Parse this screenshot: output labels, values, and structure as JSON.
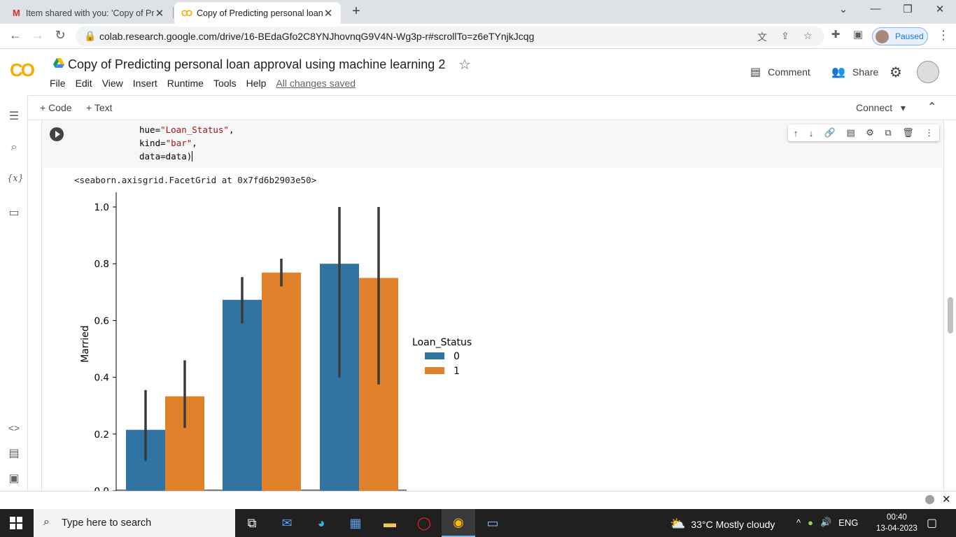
{
  "browser": {
    "tabs": [
      {
        "title": "Item shared with you: 'Copy of Pr",
        "icon": "gmail-icon"
      },
      {
        "title": "Copy of Predicting personal loan",
        "icon": "colab-icon"
      }
    ],
    "url": "colab.research.google.com/drive/16-BEdaGfo2C8YNJhovnqG9V4N-Wg3p-r#scrollTo=z6eTYnjkJcqg",
    "profile_label": "Paused"
  },
  "colab": {
    "logo_text": "CO",
    "notebook_title": "Copy of Predicting personal loan approval using machine learning 2",
    "menu": [
      "File",
      "Edit",
      "View",
      "Insert",
      "Runtime",
      "Tools",
      "Help"
    ],
    "save_status": "All changes saved",
    "comment_label": "Comment",
    "share_label": "Share",
    "add_code_label": "+ Code",
    "add_text_label": "+ Text",
    "connect_label": "Connect"
  },
  "cell": {
    "code_lines": [
      {
        "prefix": "hue=",
        "string": "\"Loan_Status\"",
        "suffix": ","
      },
      {
        "prefix": "kind=",
        "string": "\"bar\"",
        "suffix": ","
      },
      {
        "prefix": "data=data)",
        "string": "",
        "suffix": ""
      }
    ],
    "output_repr": "<seaborn.axisgrid.FacetGrid at 0x7fd6b2903e50>"
  },
  "chart_data": {
    "type": "bar",
    "ylabel": "Married",
    "yticks": [
      "0.0",
      "0.2",
      "0.4",
      "0.6",
      "0.8",
      "1.0"
    ],
    "ylim": [
      0,
      1.04
    ],
    "legend_title": "Loan_Status",
    "legend_position": "right",
    "categories_count": 3,
    "series": [
      {
        "name": "0",
        "color": "#3274a1",
        "values": [
          0.215,
          0.673,
          0.8
        ],
        "ci": [
          [
            0.105,
            0.355
          ],
          [
            0.59,
            0.753
          ],
          [
            0.4,
            1.0
          ]
        ]
      },
      {
        "name": "1",
        "color": "#e1812c",
        "values": [
          0.333,
          0.769,
          0.75
        ],
        "ci": [
          [
            0.222,
            0.46
          ],
          [
            0.72,
            0.818
          ],
          [
            0.375,
            1.0
          ]
        ]
      }
    ]
  },
  "taskbar": {
    "search_placeholder": "Type here to search",
    "weather": "33°C  Mostly cloudy",
    "language": "ENG",
    "time": "00:40",
    "date": "13-04-2023"
  }
}
